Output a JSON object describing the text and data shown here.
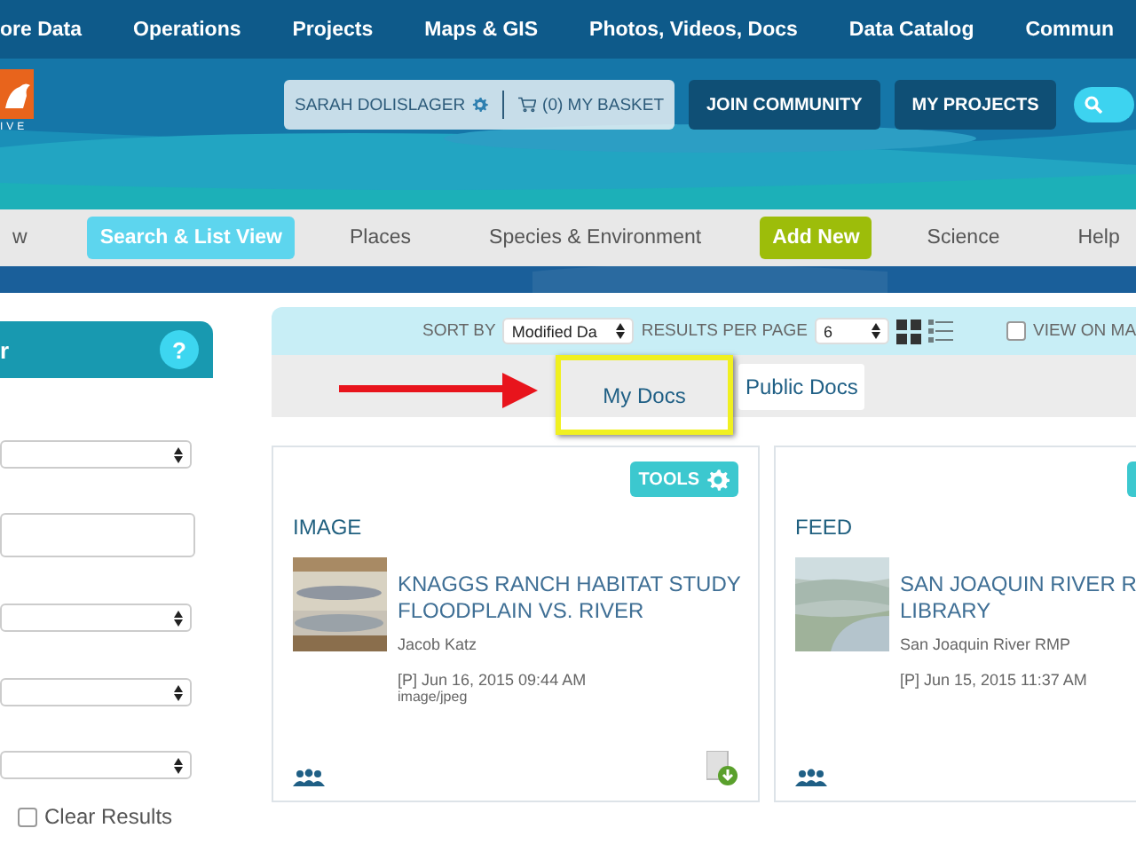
{
  "top_nav": [
    "ore Data",
    "Operations",
    "Projects",
    "Maps & GIS",
    "Photos, Videos, Docs",
    "Data Catalog",
    "Commun"
  ],
  "logo_text": "IVE",
  "user": {
    "name": "SARAH DOLISLAGER",
    "basket": "(0) MY BASKET"
  },
  "header_buttons": [
    "JOIN COMMUNITY",
    "MY PROJECTS"
  ],
  "sub_nav": [
    {
      "label": "w",
      "kind": "link",
      "selected": false
    },
    {
      "label": "Search & List View",
      "kind": "link",
      "selected": true
    },
    {
      "label": "Places",
      "kind": "link",
      "selected": false
    },
    {
      "label": "Species & Environment",
      "kind": "link",
      "selected": false
    },
    {
      "label": "Add New",
      "kind": "action",
      "selected": false
    },
    {
      "label": "Science",
      "kind": "link",
      "selected": false
    },
    {
      "label": "Help",
      "kind": "link",
      "selected": false
    }
  ],
  "sidebar": {
    "title": "r",
    "help": "?",
    "fields": [
      {
        "kind": "select"
      },
      {
        "kind": "input"
      },
      {
        "kind": "select"
      },
      {
        "kind": "select"
      },
      {
        "kind": "select"
      }
    ],
    "clear": {
      "label": "Clear Results",
      "checked": false
    }
  },
  "toolbar": {
    "sort_label": "SORT BY",
    "sort_value": "Modified Da",
    "per_page_label": "RESULTS PER PAGE",
    "per_page_value": "6",
    "grid_view_selected": true,
    "map_label": "VIEW ON MA",
    "map_checked": false
  },
  "doc_tabs": [
    {
      "label": "My Docs",
      "selected": false,
      "highlighted": true
    },
    {
      "label": "Public Docs",
      "selected": true,
      "highlighted": false
    }
  ],
  "cards": [
    {
      "tools": "TOOLS",
      "type": "IMAGE",
      "title_lines": [
        "KNAGGS RANCH HABITAT STUDY",
        "FLOODPLAIN VS. RIVER"
      ],
      "author": "Jacob Katz",
      "date": "[P] Jun 16, 2015 09:44 AM",
      "mime": "image/jpeg",
      "download": true
    },
    {
      "type": "FEED",
      "title_lines": [
        "SAN JOAQUIN RIVER R",
        "LIBRARY"
      ],
      "author": "San Joaquin River RMP",
      "date": "[P] Jun 15, 2015 11:37 AM",
      "download": false
    }
  ]
}
